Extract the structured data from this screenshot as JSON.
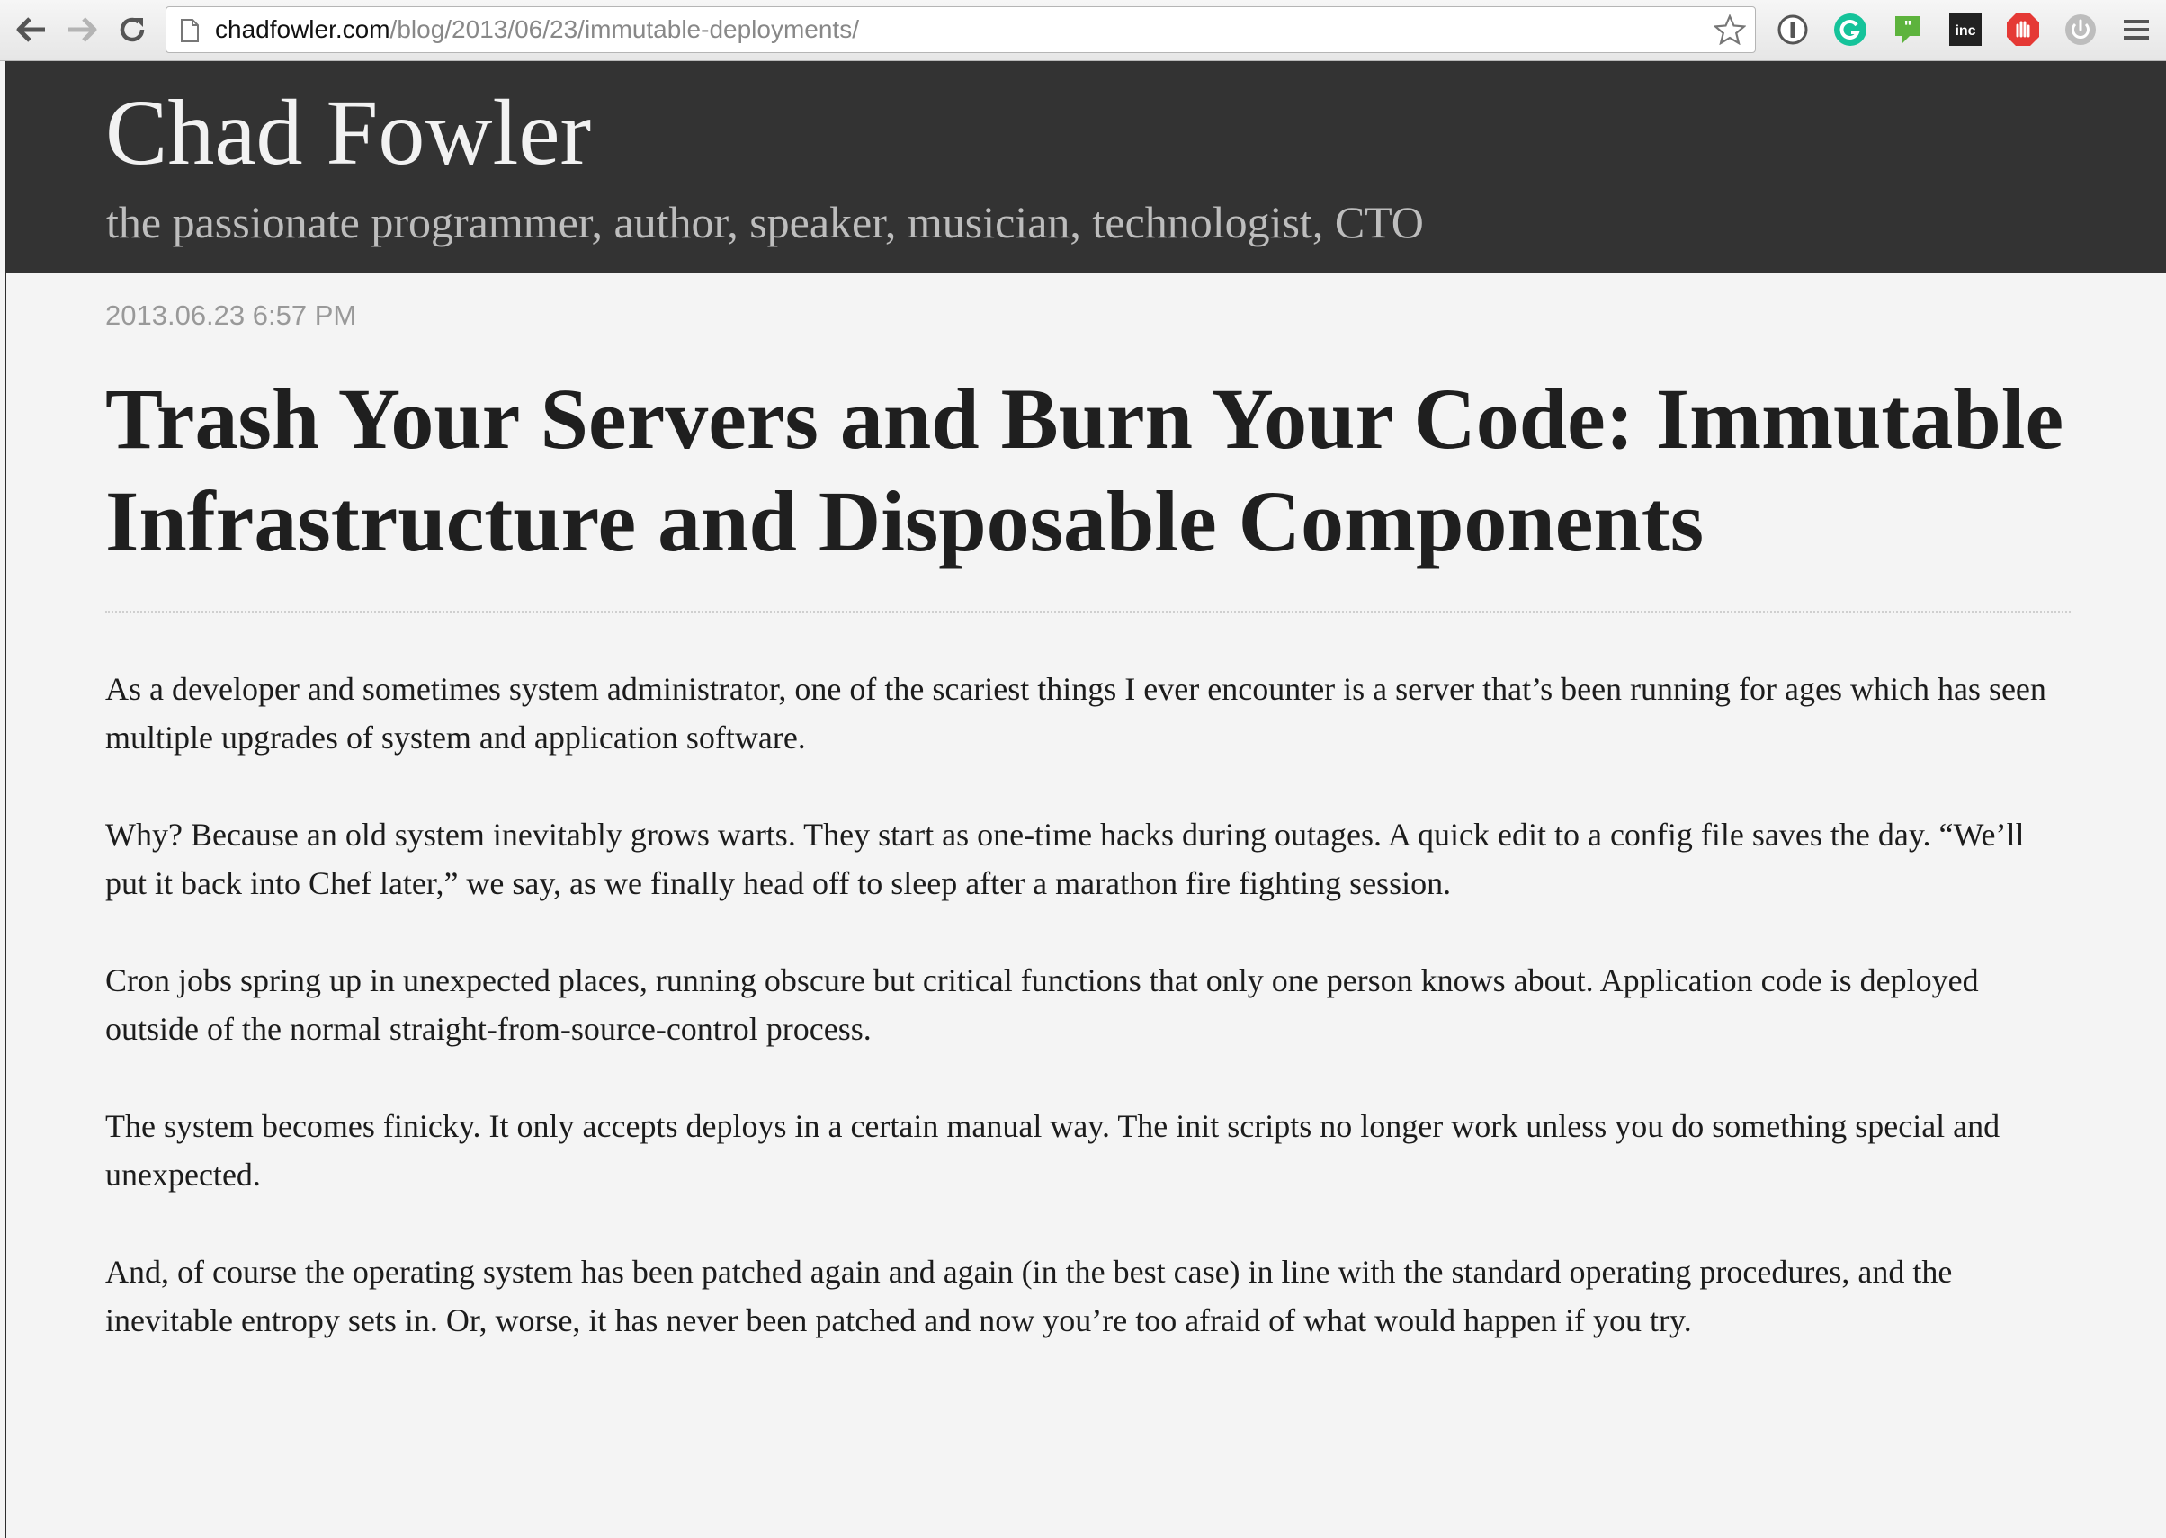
{
  "browser": {
    "url_host": "chadfowler.com",
    "url_path": "/blog/2013/06/23/immutable-deployments/",
    "icons": [
      "back-arrow-icon",
      "forward-arrow-icon",
      "reload-icon",
      "page-icon",
      "bookmark-star-icon",
      "password-manager-icon",
      "grammarly-icon",
      "quote-extension-icon",
      "inc-extension-icon",
      "adblock-icon",
      "power-extension-icon",
      "chrome-menu-icon"
    ],
    "ext_inc_label": "inc",
    "colors": {
      "grammarly": "#15c39a",
      "quote": "#5db33d",
      "adblock": "#e53935"
    }
  },
  "site": {
    "title": "Chad Fowler",
    "tagline": "the passionate programmer, author, speaker, musician, technologist, CTO",
    "header_color": "#333333"
  },
  "post": {
    "date": "2013.06.23 6:57 PM",
    "title": "Trash Your Servers and Burn Your Code: Immutable Infrastructure and Disposable Components",
    "paragraphs": [
      "As a developer and sometimes system administrator, one of the scariest things I ever encounter is a server that’s been running for ages which has seen multiple upgrades of system and application software.",
      "Why? Because an old system inevitably grows warts. They start as one-time hacks during outages. A quick edit to a config file saves the day. “We’ll put it back into Chef later,” we say, as we finally head off to sleep after a marathon fire fighting session.",
      "Cron jobs spring up in unexpected places, running obscure but critical functions that only one person knows about. Application code is deployed outside of the normal straight-from-source-control process.",
      "The system becomes finicky. It only accepts deploys in a certain manual way. The init scripts no longer work unless you do something special and unexpected.",
      "And, of course the operating system has been patched again and again (in the best case) in line with the standard operating procedures, and the inevitable entropy sets in. Or, worse, it has never been patched and now you’re too afraid of what would happen if you try."
    ]
  }
}
